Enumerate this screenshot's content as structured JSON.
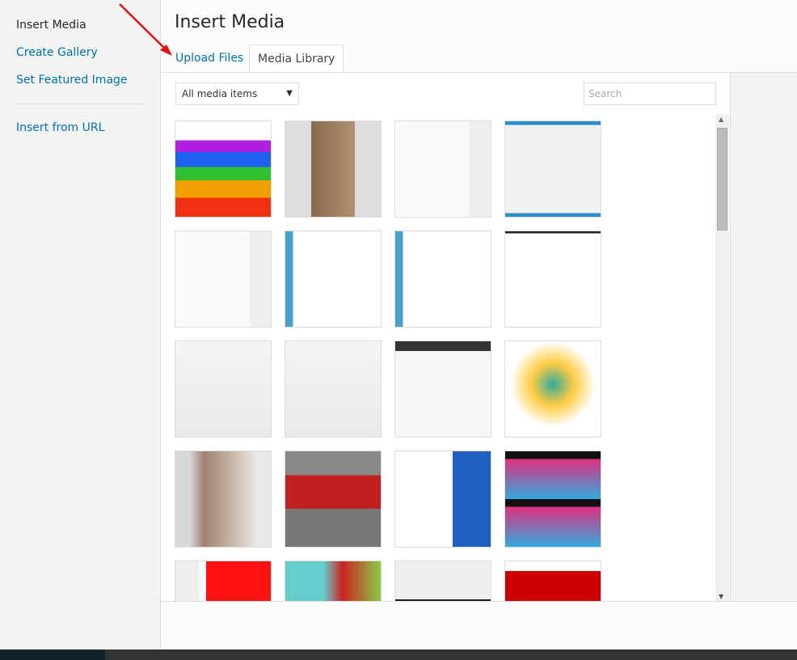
{
  "sidebar": {
    "items": [
      {
        "label": "Insert Media",
        "active": true
      },
      {
        "label": "Create Gallery"
      },
      {
        "label": "Set Featured Image"
      },
      {
        "label": "Insert from URL"
      }
    ]
  },
  "header": {
    "title": "Insert Media",
    "tabs": [
      {
        "label": "Upload Files"
      },
      {
        "label": "Media Library",
        "active": true
      }
    ]
  },
  "toolbar": {
    "filter_value": "All media items",
    "search_placeholder": "Search"
  },
  "annotation": {
    "arrow_color": "#e01010"
  },
  "thumbnails": [
    {
      "bg": "linear-gradient(#fff 20%,#b020e0 20%,#b020e0 32%,#2060f0 32%,#2060f0 48%,#30c030 48%,#30c030 62%,#f0a000 62%,#f0a000 80%,#f03010 80%)"
    },
    {
      "bg": "linear-gradient(90deg,#ddd 27%,#8a6a50 27%,#b09070 73%,#ddd 73%)"
    },
    {
      "bg": "linear-gradient(90deg,#fafafa 78%,#eee 78%)"
    },
    {
      "bg": "linear-gradient(#2c8fc8 4%,#f1f1f1 4%,#f1f1f1 96%,#2c8fc8 96%)"
    },
    {
      "bg": "linear-gradient(90deg,#fafafa 78%,#eee 78%)"
    },
    {
      "bg": "linear-gradient(90deg,#46a0c8 8%,#fff 8%)"
    },
    {
      "bg": "linear-gradient(90deg,#46a0c8 8%,#fff 8%)"
    },
    {
      "bg": "linear-gradient(#222 2%,#fff 2%)"
    },
    {
      "bg": "linear-gradient(#f4f4f4,#eaeaea)"
    },
    {
      "bg": "linear-gradient(#f4f4f4,#eaeaea)"
    },
    {
      "bg": "linear-gradient(#333 10%,#f6f6f6 10%)"
    },
    {
      "bg": "radial-gradient(circle at 50% 45%,#3a9 0,#fc4 30%,#fff 60%)"
    },
    {
      "bg": "linear-gradient(90deg,#d8d8d8 15%,#a08070 30%,#c8b8a8 60%,#e8e8e8 85%)"
    },
    {
      "bg": "linear-gradient(#888 25%,#c02020 25%,#c02020 60%,#777 60%)"
    },
    {
      "bg": "linear-gradient(90deg,#fff 60%,#2060c0 60%)"
    },
    {
      "bg": "repeating-linear-gradient(#111 0,#111 8%,#e03080 8%,#3ad 50%)"
    },
    {
      "bg": "linear-gradient(90deg,#eee 25%,#fff 25%,#fff 32%,#f11 32%)"
    },
    {
      "bg": "linear-gradient(90deg,#6cc 40%,#c22 60%,#8c4 100%)"
    },
    {
      "bg": "linear-gradient(#eee 40%,#222 40%,#222 60%,#ddd 60%)"
    },
    {
      "bg": "linear-gradient(#fff 10%,#c00 10%)"
    }
  ]
}
